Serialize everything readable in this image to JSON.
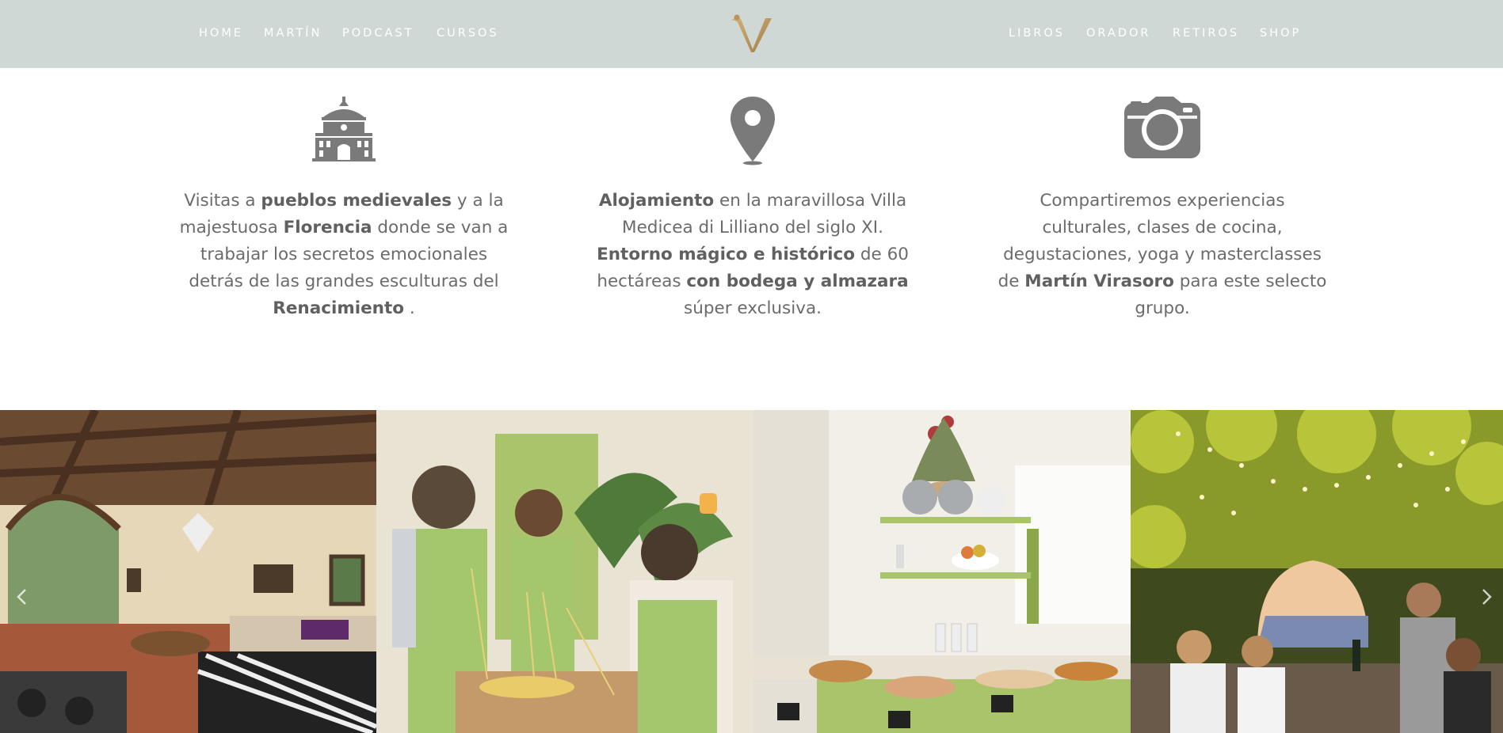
{
  "nav": {
    "left": [
      "HOME",
      "MARTÍN",
      "PODCAST",
      "CURSOS"
    ],
    "right": [
      "LIBROS",
      "ORADOR",
      "RETIROS",
      "SHOP"
    ]
  },
  "logo": {
    "letter": "V",
    "color": "#b8945a"
  },
  "features": [
    {
      "icon": "cathedral-icon"
    },
    {
      "icon": "map-pin-icon"
    },
    {
      "icon": "camera-icon"
    }
  ],
  "gallery": {
    "images": [
      "villa-living-room-photo",
      "pasta-cooking-class-photo",
      "breakfast-buffet-photo",
      "pergola-dinner-photo"
    ],
    "prev_icon": "chevron-left-icon",
    "next_icon": "chevron-right-icon"
  },
  "colors": {
    "nav_bg": "#cfd8d5",
    "text": "#6b6b6b",
    "icon": "#7a7a7a"
  }
}
